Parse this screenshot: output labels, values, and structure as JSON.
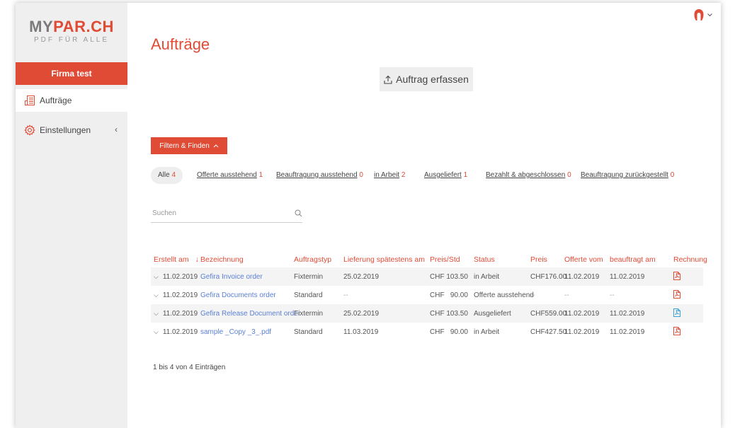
{
  "brand": {
    "logo_prefix": "MY",
    "logo_accent": "PAR.CH",
    "logo_sub": "PDF FÜR ALLE",
    "accent_color": "#e04b36"
  },
  "sidebar": {
    "company": "Firma test",
    "items": [
      {
        "label": "Aufträge",
        "icon": "document-list-icon"
      },
      {
        "label": "Einstellungen",
        "icon": "gear-icon"
      }
    ]
  },
  "page": {
    "title": "Aufträge"
  },
  "actions": {
    "create_label": "Auftrag erfassen",
    "filter_label": "Filtern & Finden"
  },
  "filters": [
    {
      "label": "Alle",
      "count": "4"
    },
    {
      "label": "Offerte ausstehend",
      "count": "1"
    },
    {
      "label": "Beauftragung ausstehend",
      "count": "0"
    },
    {
      "label": "in Arbeit",
      "count": "2"
    },
    {
      "label": "Ausgeliefert",
      "count": "1"
    },
    {
      "label": "Bezahlt & abgeschlossen",
      "count": "0"
    },
    {
      "label": "Beauftragung zurückgestellt",
      "count": "0"
    }
  ],
  "search": {
    "placeholder": "Suchen"
  },
  "table": {
    "headers": [
      "Erstellt am",
      "Bezeichnung",
      "Auftragstyp",
      "Lieferung spätestens am",
      "Preis/Std",
      "Status",
      "Preis",
      "Offerte vom",
      "beauftragt am",
      "Rechnung"
    ],
    "sort_indicator": "↓",
    "rows": [
      {
        "created": "11.02.2019",
        "name": "Gefira Invoice order",
        "type": "Fixtermin",
        "delivery": "25.02.2019",
        "rate": "CHF 103.50",
        "status": "in Arbeit",
        "price": "CHF176.00",
        "offer": "11.02.2019",
        "commissioned": "11.02.2019",
        "invoice_color": "#e04b36"
      },
      {
        "created": "11.02.2019",
        "name": "Gefira Documents order",
        "type": "Standard",
        "delivery": "--",
        "rate": "CHF   90.00",
        "status": "Offerte ausstehend",
        "price": "--",
        "offer": "--",
        "commissioned": "--",
        "invoice_color": "#e04b36"
      },
      {
        "created": "11.02.2019",
        "name": "Gefira Release Document order",
        "type": "Fixtermin",
        "delivery": "25.02.2019",
        "rate": "CHF 103.50",
        "status": "Ausgeliefert",
        "price": "CHF559.00",
        "offer": "11.02.2019",
        "commissioned": "11.02.2019",
        "invoice_color": "#3aa0d8"
      },
      {
        "created": "11.02.2019",
        "name": "sample _Copy _3_.pdf",
        "type": "Standard",
        "delivery": "11.03.2019",
        "rate": "CHF   90.00",
        "status": "in Arbeit",
        "price": "CHF427.50",
        "offer": "11.02.2019",
        "commissioned": "11.02.2019",
        "invoice_color": "#e04b36"
      }
    ]
  },
  "info": "1 bis 4 von 4 Einträgen"
}
